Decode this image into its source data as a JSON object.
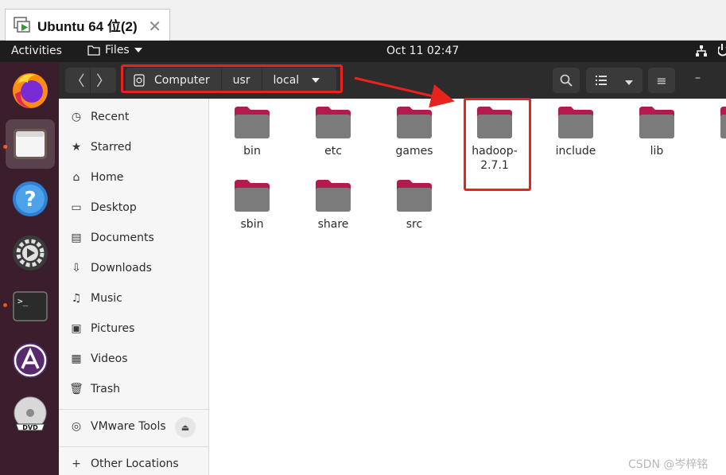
{
  "vmware_tab": {
    "title": "Ubuntu 64 位(2)",
    "close_glyph": "✕",
    "icon": "vm-play-icon"
  },
  "topbar": {
    "activities": "Activities",
    "app_menu": "Files",
    "clock": "Oct 11  02:47",
    "icons": [
      "network-icon",
      "power-icon"
    ]
  },
  "dock": {
    "items": [
      {
        "name": "firefox",
        "icon": "firefox-icon"
      },
      {
        "name": "files",
        "icon": "files-icon",
        "active": true
      },
      {
        "name": "help",
        "icon": "help-icon",
        "glyph": "?"
      },
      {
        "name": "rhythmbox",
        "icon": "settings-gear-icon"
      },
      {
        "name": "terminal",
        "icon": "terminal-icon",
        "glyph": ">_"
      },
      {
        "name": "software",
        "icon": "app-store-icon",
        "glyph": "A"
      },
      {
        "name": "dvd",
        "icon": "dvd-icon",
        "glyph": "DVD"
      }
    ]
  },
  "headerbar": {
    "back_glyph": "〈",
    "forward_glyph": "〉",
    "path": [
      "Computer",
      "usr",
      "local"
    ],
    "menu_glyph": "≡",
    "minimize_glyph": "–"
  },
  "sidebar": {
    "items": [
      {
        "label": "Recent",
        "icon": "clock-icon",
        "glyph": "◷"
      },
      {
        "label": "Starred",
        "icon": "star-icon",
        "glyph": "★"
      },
      {
        "label": "Home",
        "icon": "home-icon",
        "glyph": "⌂"
      },
      {
        "label": "Desktop",
        "icon": "desktop-icon",
        "glyph": "▭"
      },
      {
        "label": "Documents",
        "icon": "documents-icon",
        "glyph": "▤"
      },
      {
        "label": "Downloads",
        "icon": "downloads-icon",
        "glyph": "⇩"
      },
      {
        "label": "Music",
        "icon": "music-icon",
        "glyph": "♫"
      },
      {
        "label": "Pictures",
        "icon": "pictures-icon",
        "glyph": "▣"
      },
      {
        "label": "Videos",
        "icon": "videos-icon",
        "glyph": "▦"
      },
      {
        "label": "Trash",
        "icon": "trash-icon",
        "glyph": "🗑"
      }
    ],
    "devices": [
      {
        "label": "VMware Tools",
        "icon": "disc-icon",
        "glyph": "◎",
        "eject_glyph": "⏏"
      }
    ],
    "other": {
      "label": "Other Locations",
      "icon": "plus-icon",
      "glyph": "+"
    }
  },
  "folders": [
    {
      "label": "bin"
    },
    {
      "label": "etc"
    },
    {
      "label": "games"
    },
    {
      "label": "hadoop-\n2.7.1",
      "line1": "hadoop-",
      "line2": "2.7.1"
    },
    {
      "label": "include"
    },
    {
      "label": "lib"
    },
    {
      "label": ""
    },
    {
      "label": "sbin"
    },
    {
      "label": "share"
    },
    {
      "label": "src"
    }
  ],
  "colors": {
    "folder_body": "#7b7b7b",
    "folder_tab": "#c7164f",
    "highlight": "#e8231e",
    "dock_bg": "#3b1e2c",
    "header_bg": "#2c2c2c"
  },
  "watermark": "CSDN @岑梓铭"
}
